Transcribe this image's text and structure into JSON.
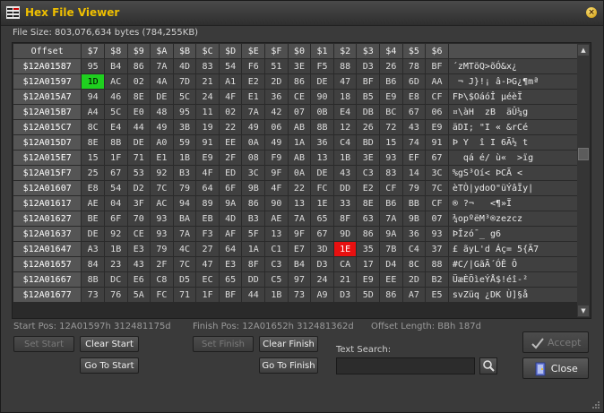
{
  "window": {
    "title": "Hex File Viewer",
    "close_icon": "close-icon"
  },
  "file_size": "File Size: 803,076,634 bytes (784,255KB)",
  "grid": {
    "offset_header": "Offset",
    "column_headers": [
      "$7",
      "$8",
      "$9",
      "$A",
      "$B",
      "$C",
      "$D",
      "$E",
      "$F",
      "$0",
      "$1",
      "$2",
      "$3",
      "$4",
      "$5",
      "$6"
    ],
    "ascii_header": "",
    "rows": [
      {
        "offset": "$12A01587",
        "bytes": [
          "95",
          "B4",
          "86",
          "7A",
          "4D",
          "83",
          "54",
          "F6",
          "51",
          "3E",
          "F5",
          "88",
          "D3",
          "26",
          "78",
          "BF"
        ],
        "ascii": "´zMTöQ>õÓ&x¿"
      },
      {
        "offset": "$12A01597",
        "bytes": [
          "1D",
          "AC",
          "02",
          "4A",
          "7D",
          "21",
          "A1",
          "E2",
          "2D",
          "86",
          "DE",
          "47",
          "BF",
          "B6",
          "6D",
          "AA"
        ],
        "ascii": " ¬ J}!¡ â-ÞG¿¶mª"
      },
      {
        "offset": "$12A015A7",
        "bytes": [
          "94",
          "46",
          "8E",
          "DE",
          "5C",
          "24",
          "4F",
          "E1",
          "36",
          "CE",
          "90",
          "18",
          "B5",
          "E9",
          "E8",
          "CF"
        ],
        "ascii": "FÞ\\$OáóÎ µéèÏ"
      },
      {
        "offset": "$12A015B7",
        "bytes": [
          "A4",
          "5C",
          "E0",
          "48",
          "95",
          "11",
          "02",
          "7A",
          "42",
          "07",
          "0B",
          "E4",
          "DB",
          "BC",
          "67",
          "06"
        ],
        "ascii": "¤\\àH  zB  äÛ¼g"
      },
      {
        "offset": "$12A015C7",
        "bytes": [
          "8C",
          "E4",
          "44",
          "49",
          "3B",
          "19",
          "22",
          "49",
          "06",
          "AB",
          "8B",
          "12",
          "26",
          "72",
          "43",
          "E9"
        ],
        "ascii": "äDI; \"I « &rCé"
      },
      {
        "offset": "$12A015D7",
        "bytes": [
          "8E",
          "8B",
          "DE",
          "A0",
          "59",
          "91",
          "EE",
          "0A",
          "49",
          "1A",
          "36",
          "C4",
          "BD",
          "15",
          "74",
          "91"
        ],
        "ascii": "Þ Y  î I 6Ä½ t"
      },
      {
        "offset": "$12A015E7",
        "bytes": [
          "15",
          "1F",
          "71",
          "E1",
          "1B",
          "E9",
          "2F",
          "08",
          "F9",
          "AB",
          "13",
          "1B",
          "3E",
          "93",
          "EF",
          "67"
        ],
        "ascii": "  qá é/ ù«  >ïg"
      },
      {
        "offset": "$12A015F7",
        "bytes": [
          "25",
          "67",
          "53",
          "92",
          "B3",
          "4F",
          "ED",
          "3C",
          "9F",
          "0A",
          "DE",
          "43",
          "C3",
          "83",
          "14",
          "3C"
        ],
        "ascii": "%gS³Oí< ÞCÃ <"
      },
      {
        "offset": "$12A01607",
        "bytes": [
          "E8",
          "54",
          "D2",
          "7C",
          "79",
          "64",
          "6F",
          "9B",
          "4F",
          "22",
          "FC",
          "DD",
          "E2",
          "CF",
          "79",
          "7C"
        ],
        "ascii": "èTÒ|ydoO\"üÝâÏy|"
      },
      {
        "offset": "$12A01617",
        "bytes": [
          "AE",
          "04",
          "3F",
          "AC",
          "94",
          "89",
          "9A",
          "86",
          "90",
          "13",
          "1E",
          "33",
          "8E",
          "B6",
          "BB",
          "CF"
        ],
        "ascii": "® ?¬   <¶»Ï"
      },
      {
        "offset": "$12A01627",
        "bytes": [
          "BE",
          "6F",
          "70",
          "93",
          "BA",
          "EB",
          "4D",
          "B3",
          "AE",
          "7A",
          "65",
          "8F",
          "63",
          "7A",
          "9B",
          "07"
        ],
        "ascii": "¾opºëM³®zezcz"
      },
      {
        "offset": "$12A01637",
        "bytes": [
          "DE",
          "92",
          "CE",
          "93",
          "7A",
          "F3",
          "AF",
          "5F",
          "13",
          "9F",
          "67",
          "9D",
          "86",
          "9A",
          "36",
          "93"
        ],
        "ascii": "ÞÎzó¯_ g6"
      },
      {
        "offset": "$12A01647",
        "bytes": [
          "A3",
          "1B",
          "E3",
          "79",
          "4C",
          "27",
          "64",
          "1A",
          "C1",
          "E7",
          "3D",
          "1E",
          "35",
          "7B",
          "C4",
          "37"
        ],
        "ascii": "£ ãyL'd Áç= 5{Ä7"
      },
      {
        "offset": "$12A01657",
        "bytes": [
          "84",
          "23",
          "43",
          "2F",
          "7C",
          "47",
          "E3",
          "8F",
          "C3",
          "B4",
          "D3",
          "CA",
          "17",
          "D4",
          "8C",
          "88"
        ],
        "ascii": "#C/|GãÃ´ÓÊ Ô"
      },
      {
        "offset": "$12A01667",
        "bytes": [
          "8B",
          "DC",
          "E6",
          "C8",
          "D5",
          "EC",
          "65",
          "DD",
          "C5",
          "97",
          "24",
          "21",
          "E9",
          "EE",
          "2D",
          "B2"
        ],
        "ascii": "ÜæÈÕìeÝÅ$!éî-²"
      },
      {
        "offset": "$12A01677",
        "bytes": [
          "73",
          "76",
          "5A",
          "FC",
          "71",
          "1F",
          "BF",
          "44",
          "1B",
          "73",
          "A9",
          "D3",
          "5D",
          "86",
          "A7",
          "E5"
        ],
        "ascii": "svZüq ¿DK Ù]§å"
      }
    ]
  },
  "positions": {
    "start_pos": "Start Pos: 12A01597h  312481175d",
    "finish_pos": "Finish Pos: 12A01652h  312481362d",
    "offset_length": "Offset Length: BBh  187d"
  },
  "buttons": {
    "set_start": "Set Start",
    "clear_start": "Clear Start",
    "set_finish": "Set Finish",
    "clear_finish": "Clear Finish",
    "go_to_start": "Go To Start",
    "go_to_finish": "Go To Finish",
    "accept": "Accept",
    "close": "Close"
  },
  "search": {
    "label": "Text Search:",
    "value": "",
    "icon": "magnifier-icon"
  },
  "colors": {
    "title": "#f0c000",
    "selection_start": "#1fd01f",
    "selection_end": "#e81010"
  }
}
